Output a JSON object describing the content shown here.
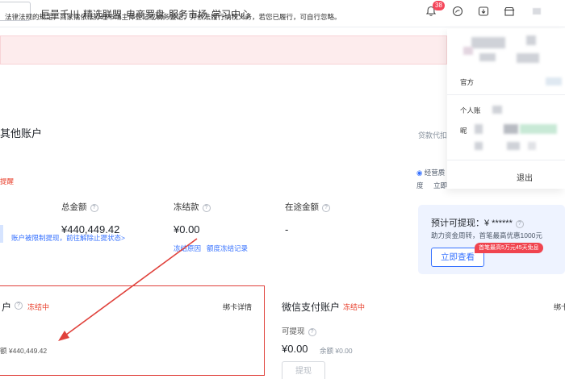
{
  "nav": {
    "items": [
      "巨量千川",
      "精选联盟",
      "电商罗盘",
      "服务市场",
      "学习中心"
    ],
    "notification_count": "38"
  },
  "notice": {
    "text": "法律法规的规定，商家需依法办理市场主体登记或税务登记，并依法履行纳税义务，若您已履行，可自行忽略。"
  },
  "section": {
    "title": "其他账户",
    "right_link": "贷款代扣",
    "tip": "提醒"
  },
  "stats": {
    "total_label": "总金额",
    "total_value": "¥440,449.42",
    "frozen_label": "冻结款",
    "frozen_value": "¥0.00",
    "frozen_reason": "冻结原因",
    "quota_record": "额度冻结记录",
    "transit_label": "在途金额",
    "transit_value": "-",
    "warn_text": "账户被限制提现，前往解除止提状态>"
  },
  "account_left": {
    "title": "户",
    "status": "冻结中",
    "bind_card": "绑卡详情",
    "balance_text": "额 ¥440,449.42"
  },
  "account_right": {
    "title": "微信支付账户",
    "status": "冻结中",
    "withdrawable_label": "可提现",
    "value": "¥0.00",
    "balance_text": "余额 ¥0.00",
    "withdraw_button": "提现",
    "bind_card": "绑卡"
  },
  "promo": {
    "title": "预计可提现：¥ ******",
    "sub": "助力资金周转，首笔最高优惠1000元",
    "tag": "首笔最高5万元45天免息",
    "button": "立即查看"
  },
  "side": {
    "operation_label": "经营质",
    "line2_a": "度",
    "line2_b": "立即"
  },
  "panel": {
    "official_label": "官方",
    "personal_label": "个人账",
    "nickname_label": "昵",
    "logout": "退出"
  },
  "colors": {
    "accent": "#3772ff",
    "danger": "#e8412d",
    "notice_bg": "#fdeced"
  }
}
